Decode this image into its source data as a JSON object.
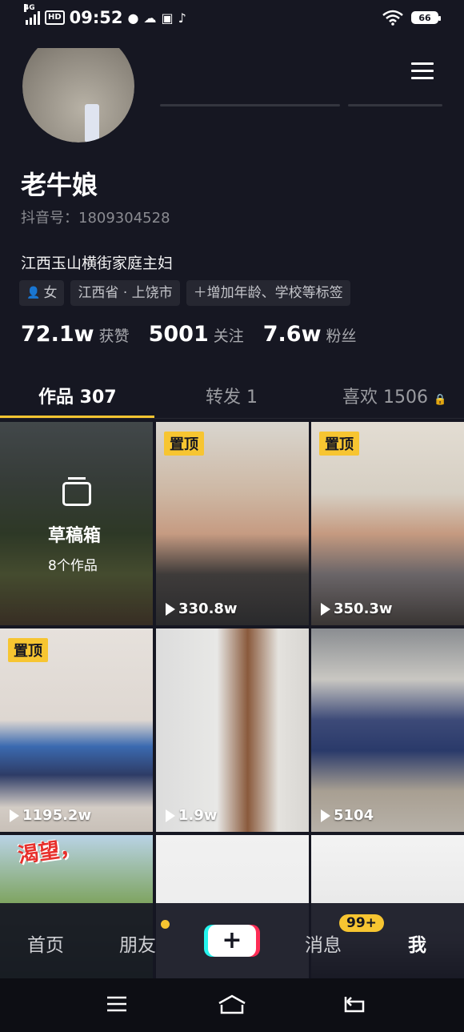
{
  "status_bar": {
    "network": "4G",
    "hd": "HD",
    "time": "09:52",
    "battery": "66"
  },
  "profile": {
    "nickname": "老牛娘",
    "douyin_id": "抖音号：1809304528",
    "bio": "江西玉山横街家庭主妇",
    "tags": {
      "gender": "女",
      "location": "江西省 · 上饶市",
      "add": "＋增加年龄、学校等标签"
    },
    "stats": {
      "likes": {
        "value": "72.1w",
        "label": "获赞"
      },
      "following": {
        "value": "5001",
        "label": "关注"
      },
      "followers": {
        "value": "7.6w",
        "label": "粉丝"
      }
    }
  },
  "tabs": {
    "works": "作品 307",
    "reposts": "转发 1",
    "likes": "喜欢 1506"
  },
  "drafts": {
    "title": "草稿箱",
    "count": "8个作品"
  },
  "pinned_label": "置顶",
  "videos": [
    {
      "plays": "330.8w",
      "pinned": true
    },
    {
      "plays": "350.3w",
      "pinned": true
    },
    {
      "plays": "1195.2w",
      "pinned": true
    },
    {
      "plays": "1.9w",
      "pinned": false
    },
    {
      "plays": "5104",
      "pinned": false
    }
  ],
  "thumb_overlay_text": "渴望，",
  "bottom_nav": {
    "home": "首页",
    "friends": "朋友",
    "messages": "消息",
    "messages_badge": "99+",
    "me": "我"
  },
  "colors": {
    "background": "#161722",
    "accent": "#f7c531",
    "cyan": "#25f4ee",
    "pink": "#fe2c55"
  },
  "icons": [
    "menu-icon",
    "wifi-icon",
    "female-icon",
    "lock-icon",
    "draft-box-icon",
    "play-icon",
    "plus-icon",
    "system-menu-icon",
    "system-home-icon",
    "system-back-icon"
  ]
}
